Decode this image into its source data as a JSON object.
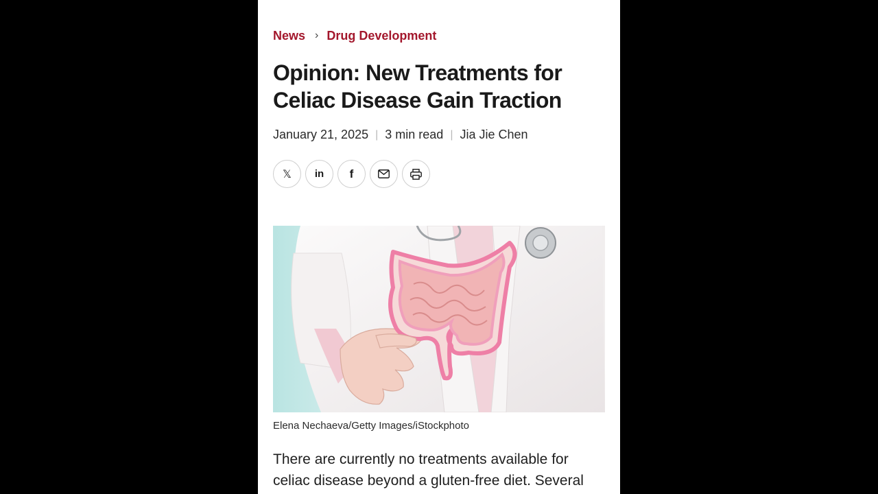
{
  "breadcrumb": {
    "items": [
      "News",
      "Drug Development"
    ],
    "separator": "›"
  },
  "article": {
    "title": "Opinion: New Treatments for Celiac Disease Gain Traction",
    "date": "January 21, 2025",
    "read_time": "3 min read",
    "author": "Jia Jie Chen",
    "image_caption": "Elena Nechaeva/Getty Images/iStockphoto",
    "body_intro": "There are currently no treatments available for celiac disease beyond a gluten-free diet. Several"
  },
  "share": {
    "buttons": [
      {
        "icon": "x-icon",
        "glyph": "𝕏"
      },
      {
        "icon": "linkedin-icon",
        "glyph": "in"
      },
      {
        "icon": "facebook-icon",
        "glyph": "f"
      },
      {
        "icon": "email-icon"
      },
      {
        "icon": "print-icon"
      }
    ]
  },
  "colors": {
    "accent": "#a3172c",
    "text": "#1a1a1a",
    "background": "#ffffff",
    "letterbox": "#000000"
  }
}
